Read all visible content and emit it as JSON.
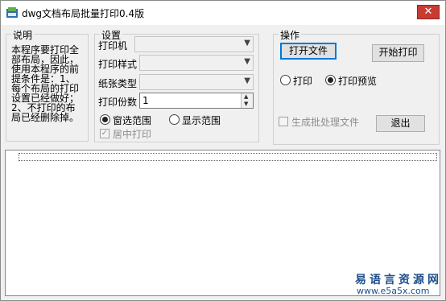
{
  "window": {
    "title": "dwg文档布局批量打印0.4版",
    "close_glyph": "✕"
  },
  "description": {
    "title": "说明",
    "text": "本程序要打印全部布局，因此，使用本程序的前提条件是：1、每个布局的打印设置已经做好；2、不打印的布局已经删除掉。"
  },
  "settings": {
    "title": "设置",
    "printer_label": "打印机",
    "printer_value": "",
    "print_style_label": "打印样式",
    "print_style_value": "",
    "paper_type_label": "纸张类型",
    "paper_type_value": "",
    "copies_label": "打印份数",
    "copies_value": "1",
    "window_range_label": "窗选范围",
    "display_range_label": "显示范围",
    "range_selected": "窗选范围",
    "center_print_label": "居中打印",
    "center_print_checked": true,
    "center_print_enabled": false
  },
  "operations": {
    "title": "操作",
    "open_file_label": "打开文件",
    "start_print_label": "开始打印",
    "print_label": "打印",
    "print_preview_label": "打印预览",
    "mode_selected": "打印预览",
    "batch_file_label": "生成批处理文件",
    "batch_file_checked": false,
    "exit_label": "退出"
  },
  "watermark": {
    "line1": "易语言资源网",
    "line2": "www.e5a5x.com"
  },
  "colors": {
    "close_red": "#c83b32",
    "accent_blue": "#0078d7",
    "watermark_blue": "#1f4e8c"
  }
}
